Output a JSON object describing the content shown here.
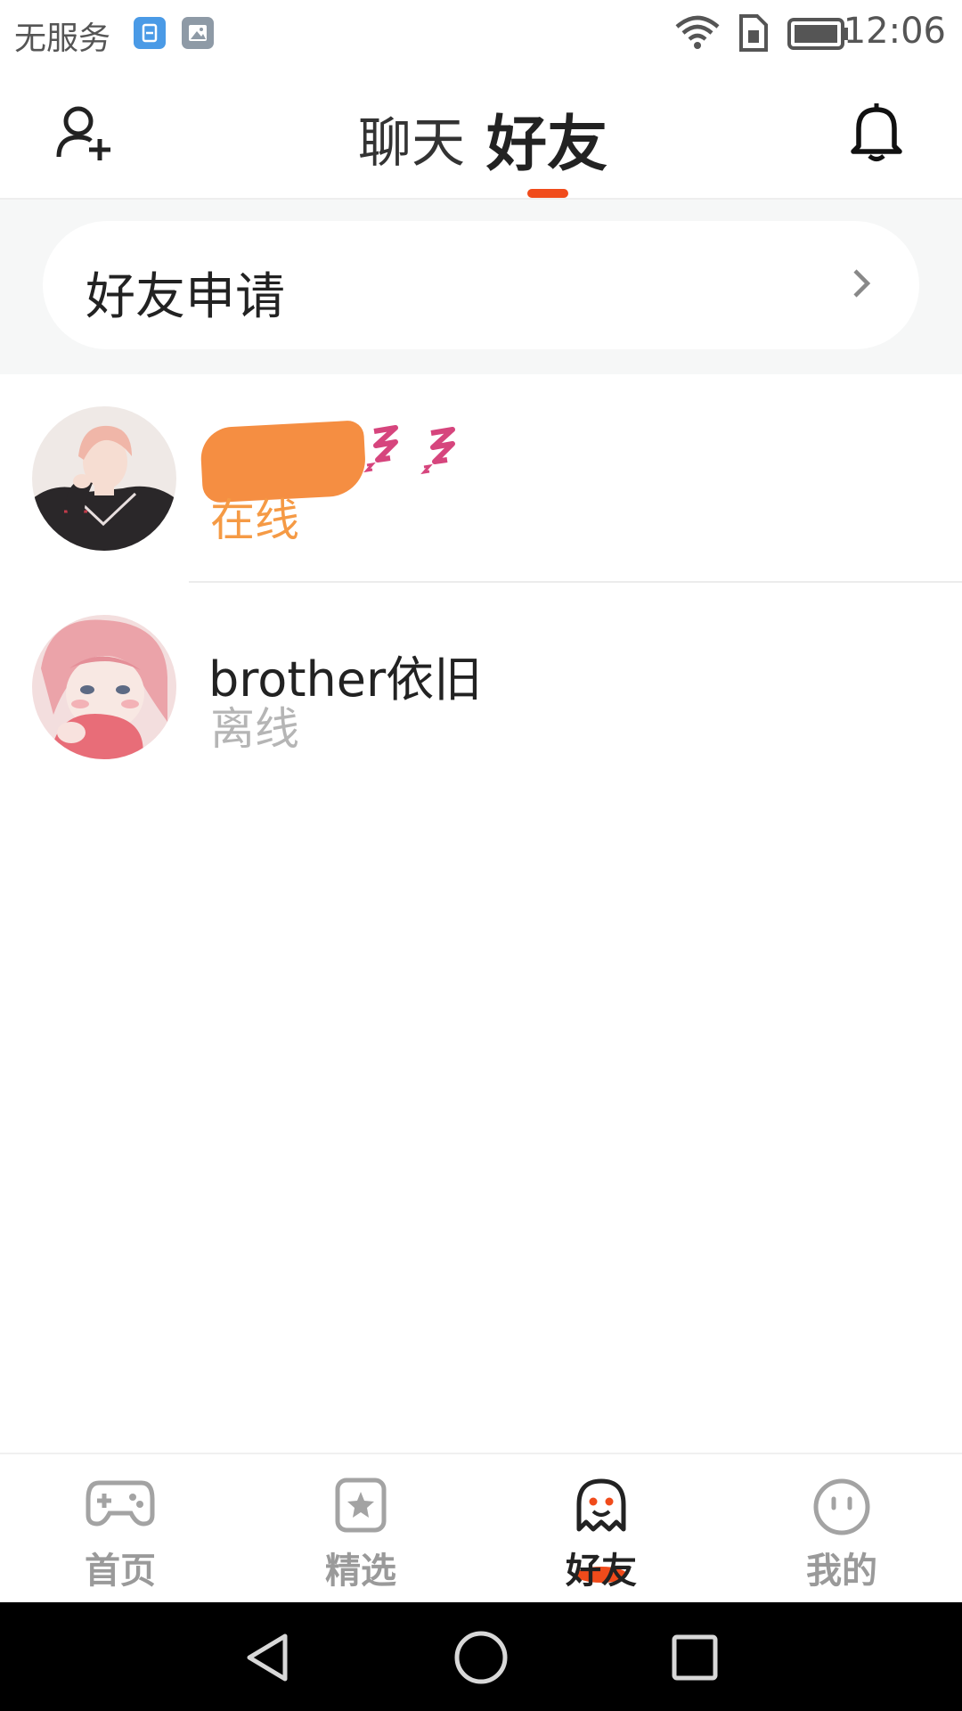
{
  "status_bar": {
    "carrier": "无服务",
    "time": "12:06",
    "icons": [
      "app-notification-icon",
      "image-notification-icon",
      "wifi-icon",
      "sim-icon",
      "battery-icon"
    ]
  },
  "header": {
    "tabs": [
      {
        "label": "聊天",
        "active": false
      },
      {
        "label": "好友",
        "active": true
      }
    ],
    "left_icon": "add-friend-icon",
    "right_icon": "bell-icon",
    "accent": "#F04B1B"
  },
  "friend_request": {
    "label": "好友申请"
  },
  "friends": [
    {
      "name": "",
      "status": "在线",
      "status_color": "#F59A45",
      "sleep_marks": "z z"
    },
    {
      "name": "brother依旧",
      "status": "离线",
      "status_color": "#B5B5B5"
    }
  ],
  "bottom_nav": {
    "items": [
      {
        "label": "首页",
        "icon": "gamepad-icon",
        "active": false
      },
      {
        "label": "精选",
        "icon": "star-icon",
        "active": false
      },
      {
        "label": "好友",
        "icon": "ghost-icon",
        "active": true
      },
      {
        "label": "我的",
        "icon": "smiley-icon",
        "active": false
      }
    ]
  },
  "system_nav": {
    "icons": [
      "back-icon",
      "home-icon",
      "recents-icon"
    ]
  }
}
